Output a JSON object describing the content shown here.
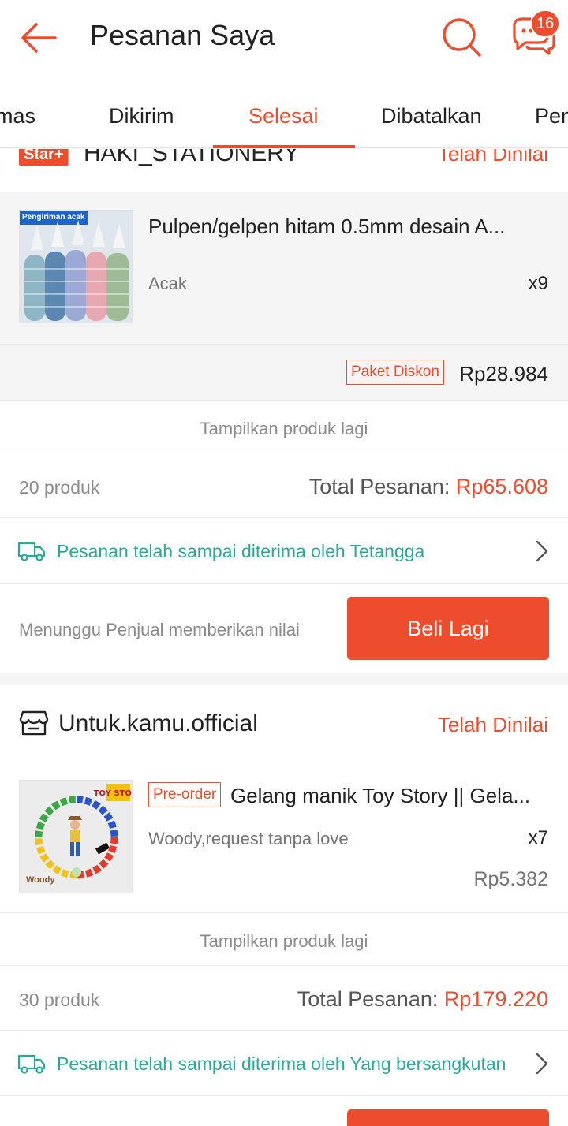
{
  "header": {
    "title": "Pesanan Saya",
    "chat_badge": "16",
    "colors": {
      "accent": "#ee4d2d",
      "teal": "#26aa99"
    }
  },
  "tabs": [
    {
      "label": "mas"
    },
    {
      "label": "Dikirim"
    },
    {
      "label": "Selesai",
      "active": true
    },
    {
      "label": "Dibatalkan"
    },
    {
      "label": "Pen"
    }
  ],
  "orders": [
    {
      "shop_badge": "Star+",
      "shop_name": "HAKI_STATIONERY",
      "status": "Telah Dinilai",
      "product": {
        "image_label": "Pengiriman acak",
        "name": "Pulpen/gelpen hitam 0.5mm desain A...",
        "variant": "Acak",
        "qty": "x9"
      },
      "discount_tag": "Paket Diskon",
      "price": "Rp28.984",
      "show_more": "Tampilkan produk lagi",
      "count": "20 produk",
      "total_label": "Total Pesanan:",
      "total_amount": "Rp65.608",
      "shipping": "Pesanan telah sampai diterima oleh Tetangga",
      "waiting": "Menunggu Penjual memberikan nilai",
      "buy_again": "Beli Lagi"
    },
    {
      "shop_name": "Untuk.kamu.official",
      "status": "Telah Dinilai",
      "product": {
        "image_label": "Woody",
        "image_logo": "TOY STORY",
        "preorder_tag": "Pre-order",
        "name": "Gelang manik Toy Story || Gela...",
        "variant": "Woody,request tanpa love",
        "qty": "x7",
        "price": "Rp5.382"
      },
      "show_more": "Tampilkan produk lagi",
      "count": "30 produk",
      "total_label": "Total Pesanan:",
      "total_amount": "Rp179.220",
      "shipping": "Pesanan telah sampai diterima oleh Yang bersangkutan"
    }
  ]
}
